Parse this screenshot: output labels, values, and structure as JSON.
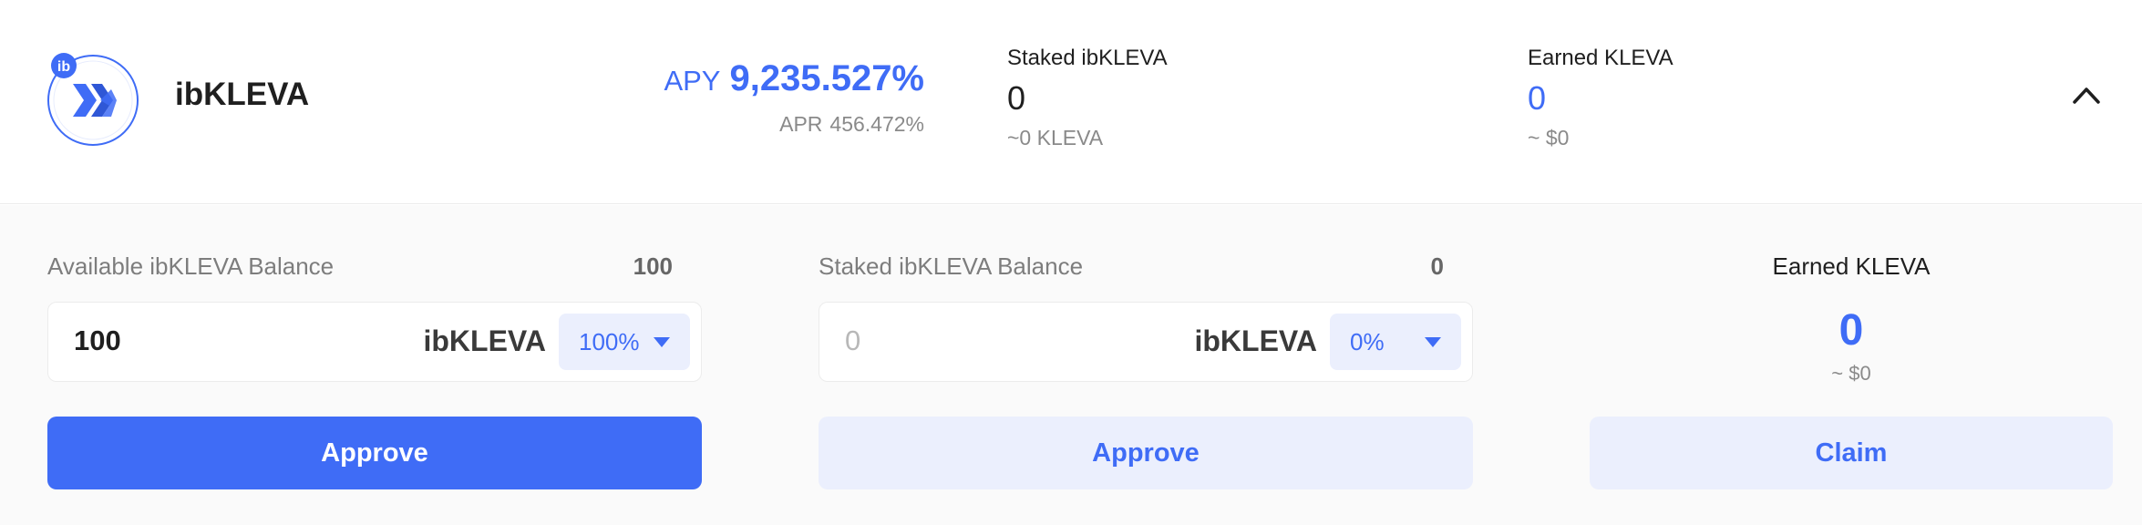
{
  "pool": {
    "token_name": "ibKLEVA",
    "logo_badge": "ib",
    "apy_label": "APY",
    "apy_value": "9,235.527%",
    "apr_label": "APR",
    "apr_value": "456.472%",
    "staked": {
      "label": "Staked ibKLEVA",
      "value": "0",
      "sub": "~0 KLEVA"
    },
    "earned": {
      "label": "Earned KLEVA",
      "value": "0",
      "sub": "~ $0"
    }
  },
  "deposit": {
    "label": "Available ibKLEVA Balance",
    "balance": "100",
    "input_value": "100",
    "unit": "ibKLEVA",
    "percent": "100%",
    "button": "Approve"
  },
  "withdraw": {
    "label": "Staked ibKLEVA Balance",
    "balance": "0",
    "input_placeholder": "0",
    "unit": "ibKLEVA",
    "percent": "0%",
    "button": "Approve"
  },
  "claim": {
    "label": "Earned KLEVA",
    "value": "0",
    "sub": "~ $0",
    "button": "Claim"
  },
  "colors": {
    "accent": "#3f6cf6",
    "accent_light": "#ebeffd",
    "muted_text": "#8a8a8a"
  },
  "icons": {
    "token": "ibkleva-token-icon",
    "collapse": "chevron-up-icon",
    "dropdown": "caret-down-icon"
  }
}
